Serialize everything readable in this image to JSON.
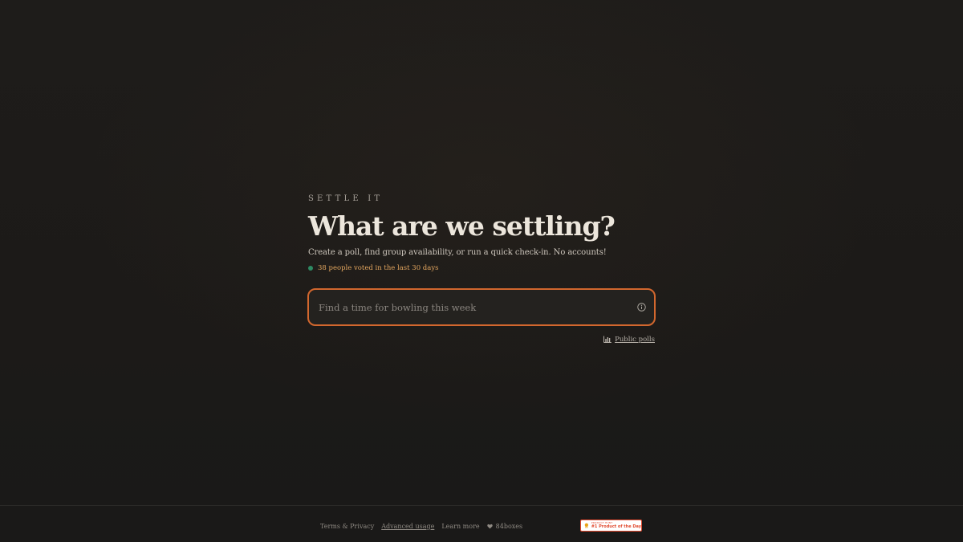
{
  "hero": {
    "eyebrow": "SETTLE IT",
    "title": "What are we settling?",
    "subtitle": "Create a poll, find group availability, or run a quick check-in. No accounts!",
    "activity": {
      "text": "38 people voted in the last 30 days",
      "dot_color": "#2e8a63",
      "text_color": "#e3a65f"
    }
  },
  "search": {
    "placeholder": "Find a time for bowling this week",
    "value": "",
    "info_icon": "info-circle-icon",
    "border_color": "#d2672e"
  },
  "public_polls": {
    "icon": "bar-chart-icon",
    "label": "Public polls"
  },
  "footer": {
    "links": [
      {
        "label": "Terms & Privacy"
      },
      {
        "label": "Advanced usage"
      },
      {
        "label": "Learn more"
      },
      {
        "label": "84boxes",
        "icon": "heart-icon"
      }
    ],
    "badge": {
      "top": "PRODUCT HUNT",
      "main": "#1 Product of the Day",
      "icon": "medal-icon",
      "color": "#e14a2f"
    }
  }
}
